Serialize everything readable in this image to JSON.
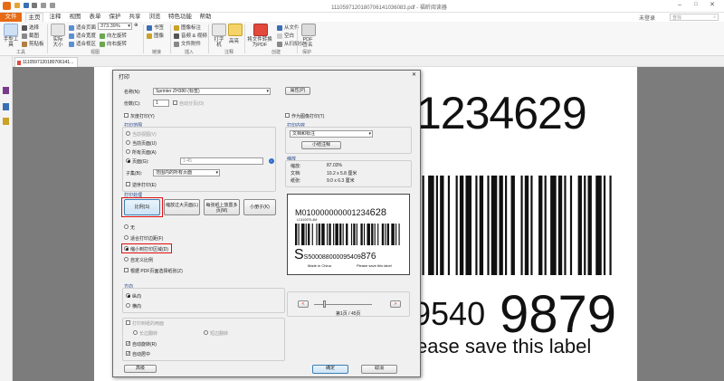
{
  "app": {
    "file_tab": "文件",
    "tabs": [
      "主页",
      "注释",
      "视图",
      "表单",
      "保护",
      "共享",
      "浏览",
      "特色功能",
      "帮助"
    ],
    "window_title": "1110597120180706141036083.pdf - 福昕阅读器",
    "user": "未登录",
    "search_placeholder": "查找"
  },
  "ribbon": {
    "hand_tool": "手型工具",
    "select_text": "选择",
    "snapshot": "截图",
    "clipboard": "剪贴板",
    "actual_size": "实际大小",
    "fit_page": "适合页面",
    "fit_width": "适合宽度",
    "fit_visible": "适合视区",
    "zoom_value": "373.39%",
    "rotate_left": "向左旋转",
    "rotate_right": "向右旋转",
    "bookmark": "书签",
    "image": "图像",
    "image_annot": "图像标注",
    "audio_video": "音频 & 视频",
    "file_attach": "文件附件",
    "typewriter": "打字机",
    "highlight": "高亮",
    "from_file": "从文件",
    "from_scanner": "从扫描仪",
    "blank": "空白",
    "convert": "将文件转换为PDF",
    "pdf_sign": "PDF签名",
    "groups": {
      "tools": "工具",
      "view": "视图",
      "links": "链接",
      "insert": "插入",
      "comment": "注释",
      "create": "创建",
      "protect": "保护"
    }
  },
  "doc_tab": "1110597120180706141...",
  "page_content": {
    "number_top": "1234629",
    "number_middle_small": "9540",
    "number_middle_large": "9879",
    "footer_text": "ease save this label"
  },
  "dialog": {
    "title": "打印",
    "printer_name_label": "名称(N):",
    "printer_name": "Sprinter ZH380 (标签)",
    "properties_button": "属性(P)",
    "copies_label": "份数(C):",
    "copies_value": "1",
    "collate": "自动分页(O)",
    "grayscale": "灰度打印(Y)",
    "print_as_image": "作为图像打印(T)",
    "print_range_header": "打印范围",
    "range_current_view": "当前视图(V)",
    "range_current_page": "当前页面(U)",
    "range_all": "所有页面(A)",
    "range_pages": "页面(G):",
    "range_pages_value": "1-45",
    "subset_label": "子集(B):",
    "subset_value": "范围内的所有页面",
    "reverse": "逆序打印(E)",
    "handling_header": "打印处理",
    "btn_scale": "比例(S)",
    "btn_tile": "缩放过大页面(L)",
    "btn_multiple": "每张纸上放置多页(M)",
    "btn_booklet": "小册子(K)",
    "scale_none": "无",
    "scale_fit": "适合打印边距(F)",
    "scale_shrink": "缩小到打印区域(D)",
    "scale_custom": "自定义比例",
    "choose_paper": "根据 PDF页面选择纸张(Z)",
    "orientation_header": "方向",
    "portrait": "纵向",
    "landscape": "横向",
    "duplex_header": "打印到纸的两面",
    "flip_long": "长边翻转",
    "flip_short": "短边翻转",
    "auto_rotate": "自动旋转(R)",
    "auto_center": "自动居中",
    "advanced_button": "高级",
    "ok_button": "确定",
    "cancel_button": "取消",
    "annotations_header": "打印内容",
    "annotations_value": "文档和标注",
    "summarize_button": "小结注释",
    "zoom_header": "缩放",
    "zoom_label": "缩放:",
    "zoom_value": "87.03%",
    "doc_label": "文档:",
    "doc_size": "10.2 x 5.8 厘米",
    "paper_label": "纸张:",
    "paper_size": "9.0 x 6.3 厘米",
    "page_indicator": "第1页 / 45页",
    "preview": {
      "line1_small": "M010000000001234",
      "line1_big": "628",
      "line2": "LC410970-4M",
      "line3_s": "S",
      "line3_small": "S500088000095409",
      "line3_big": "876",
      "line4_left": "Made in China",
      "line4_right": "Please save this label"
    }
  },
  "colors": {
    "file_tab": "#e76a14",
    "highlight_red": "#e01010",
    "viewer_bg": "#7c7c7c",
    "dialog_bg": "#f0f0f0"
  }
}
